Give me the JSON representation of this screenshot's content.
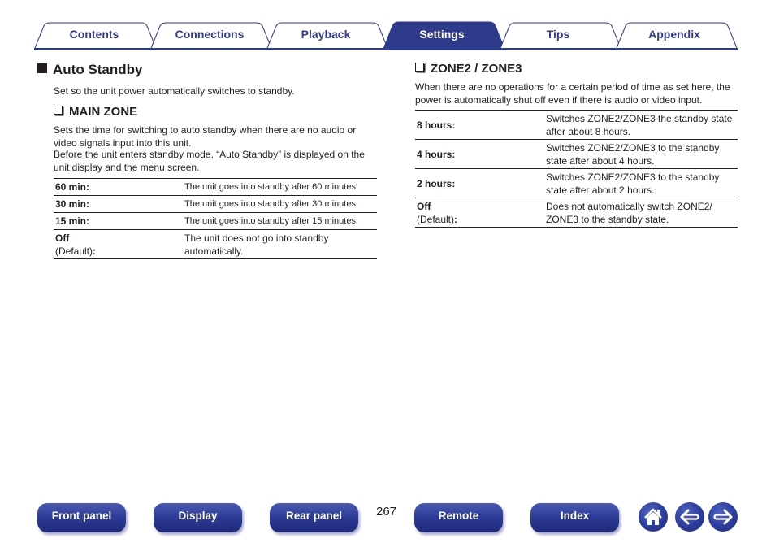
{
  "tabs": [
    {
      "label": "Contents",
      "active": false
    },
    {
      "label": "Connections",
      "active": false
    },
    {
      "label": "Playback",
      "active": false
    },
    {
      "label": "Settings",
      "active": true
    },
    {
      "label": "Tips",
      "active": false
    },
    {
      "label": "Appendix",
      "active": false
    }
  ],
  "colors": {
    "brand": "#2e3a8c",
    "text": "#231f20"
  },
  "section": {
    "title": "Auto Standby",
    "intro": "Set so the unit power automatically switches to standby."
  },
  "main_zone": {
    "title": "MAIN ZONE",
    "desc1": "Sets the time for switching to auto standby when there are no audio or video signals input into this unit.",
    "desc2": "Before the unit enters standby mode, “Auto Standby” is displayed on the unit display and the menu screen.",
    "rows": [
      {
        "key": "60 min:",
        "value": "The unit goes into standby after 60 minutes."
      },
      {
        "key": "30 min:",
        "value": "The unit goes into standby after 30 minutes."
      },
      {
        "key": "15 min:",
        "value": "The unit goes into standby after 15 minutes."
      },
      {
        "key": "Off",
        "default": "(Default)",
        "colon": ":",
        "value": "The unit does not go into standby automatically."
      }
    ]
  },
  "zone23": {
    "title": "ZONE2 / ZONE3",
    "desc": "When there are no operations for a certain period of time as set here, the power is automatically shut off even if there is audio or video input.",
    "rows": [
      {
        "key": "8 hours:",
        "value": "Switches ZONE2/ZONE3 the standby state after about 8 hours."
      },
      {
        "key": "4 hours:",
        "value": "Switches ZONE2/ZONE3 to the standby state after about 4 hours."
      },
      {
        "key": "2 hours:",
        "value": "Switches ZONE2/ZONE3 to the standby state after about 2 hours."
      },
      {
        "key": "Off",
        "default": "(Default)",
        "colon": ":",
        "value": "Does not automatically switch ZONE2/ ZONE3 to the standby state."
      }
    ]
  },
  "footer": {
    "page_number": "267",
    "buttons": [
      "Front panel",
      "Display",
      "Rear panel",
      "Remote",
      "Index"
    ],
    "icons": [
      "home-icon",
      "back-arrow-icon",
      "forward-arrow-icon"
    ]
  }
}
